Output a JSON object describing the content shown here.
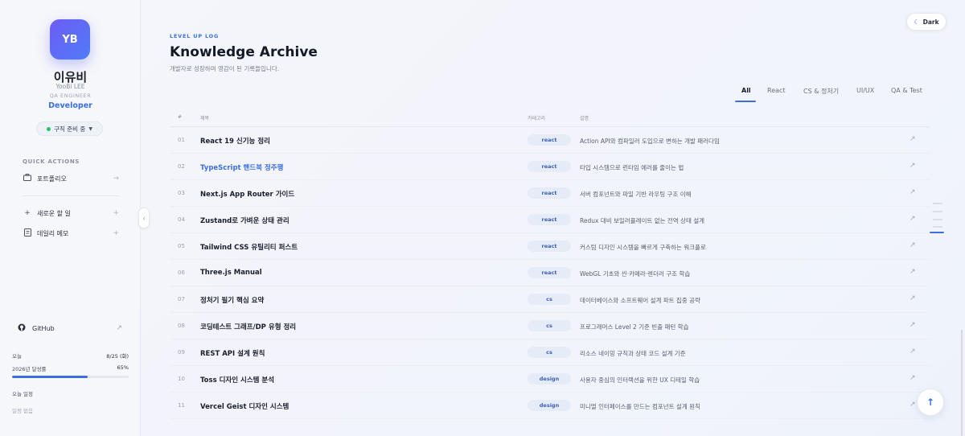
{
  "profile": {
    "initials": "YB",
    "name": "이유비",
    "name_en": "YooBi LEE",
    "role_small": "QA ENGINEER",
    "role": "Developer",
    "status": "구직 준비 중"
  },
  "quick_actions": {
    "title": "QUICK ACTIONS",
    "portfolio": "포트폴리오",
    "new_todo": "새로운 할 일",
    "daily_memo": "데일리 메모"
  },
  "github": {
    "label": "GitHub"
  },
  "today": {
    "label": "오늘",
    "date": "8/25 (화)",
    "goal_label": "2026년 달성률",
    "goal_value": "65%",
    "goal_fraction": 0.65,
    "schedule_label": "오늘 일정",
    "schedule_empty": "일정 없음"
  },
  "header": {
    "eyebrow": "LEVEL UP LOG",
    "title": "Knowledge Archive",
    "subtitle": "개발자로 성장하며 영감이 된 기록들입니다."
  },
  "theme_toggle": {
    "label": "Dark"
  },
  "tabs": [
    {
      "label": "All",
      "active": true
    },
    {
      "label": "React"
    },
    {
      "label": "CS & 정처기"
    },
    {
      "label": "UI/UX"
    },
    {
      "label": "QA & Test"
    }
  ],
  "table": {
    "headers": {
      "num": "#",
      "title": "제목",
      "category": "카테고리",
      "desc": "설명"
    },
    "rows": [
      {
        "num": "01",
        "title": "React 19 신기능 정리",
        "category": "react",
        "desc": "Action API와 컴파일러 도입으로 변하는 개발 패러다임"
      },
      {
        "num": "02",
        "title": "TypeScript 핸드북 정주행",
        "category": "react",
        "desc": "타입 시스템으로 런타임 에러를 줄이는 법",
        "hovered": true
      },
      {
        "num": "03",
        "title": "Next.js App Router 가이드",
        "category": "react",
        "desc": "서버 컴포넌트와 파일 기반 라우팅 구조 이해"
      },
      {
        "num": "04",
        "title": "Zustand로 가벼운 상태 관리",
        "category": "react",
        "desc": "Redux 대비 보일러플레이트 없는 전역 상태 설계"
      },
      {
        "num": "05",
        "title": "Tailwind CSS 유틸리티 퍼스트",
        "category": "react",
        "desc": "커스텀 디자인 시스템을 빠르게 구축하는 워크플로"
      },
      {
        "num": "06",
        "title": "Three.js Manual",
        "category": "react",
        "desc": "WebGL 기초와 씬·카메라·렌더러 구조 학습"
      },
      {
        "num": "07",
        "title": "정처기 필기 핵심 요약",
        "category": "cs",
        "desc": "데이터베이스와 소프트웨어 설계 파트 집중 공략"
      },
      {
        "num": "08",
        "title": "코딩테스트 그래프/DP 유형 정리",
        "category": "cs",
        "desc": "프로그래머스 Level 2 기준 빈출 패턴 학습"
      },
      {
        "num": "09",
        "title": "REST API 설계 원칙",
        "category": "cs",
        "desc": "리소스 네이밍 규칙과 상태 코드 설계 기준"
      },
      {
        "num": "10",
        "title": "Toss 디자인 시스템 분석",
        "category": "design",
        "desc": "사용자 중심의 인터랙션을 위한 UX 디테일 학습"
      },
      {
        "num": "11",
        "title": "Vercel Geist 디자인 시스템",
        "category": "design",
        "desc": "미니멀 인터페이스를 만드는 컴포넌트 설계 원칙"
      }
    ]
  },
  "icons": {
    "portfolio": "briefcase-icon",
    "new_todo": "plus-icon",
    "daily_memo": "memo-icon",
    "github": "github-icon",
    "theme": "moon-icon",
    "row_link": "external-arrow-icon",
    "scroll_top": "arrow-up-icon"
  },
  "colors": {
    "accent": "#3b6fe0",
    "avatar_start": "#6d5cf6",
    "avatar_end": "#4f7cf7",
    "status": "#22c55e"
  }
}
